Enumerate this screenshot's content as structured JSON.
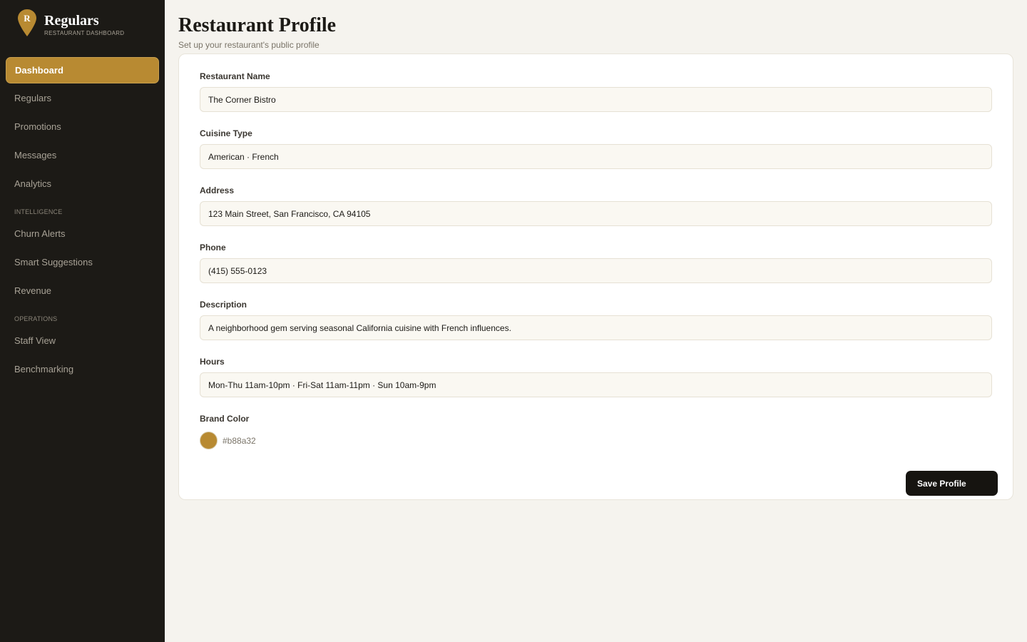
{
  "brand": {
    "initial": "R",
    "name": "Regulars",
    "subtitle": "RESTAURANT DASHBOARD",
    "accent": "#b88a32"
  },
  "sidebar": {
    "items": [
      {
        "label": "Dashboard",
        "active": true
      },
      {
        "label": "Regulars"
      },
      {
        "label": "Promotions"
      },
      {
        "label": "Messages"
      },
      {
        "label": "Analytics"
      }
    ],
    "section_intelligence": "INTELLIGENCE",
    "intelligence_items": [
      {
        "label": "Churn Alerts"
      },
      {
        "label": "Smart Suggestions"
      },
      {
        "label": "Revenue"
      }
    ],
    "section_operations": "OPERATIONS",
    "operations_items": [
      {
        "label": "Staff View"
      },
      {
        "label": "Benchmarking"
      }
    ]
  },
  "page": {
    "title": "Restaurant Profile",
    "subtitle": "Set up your restaurant's public profile"
  },
  "form": {
    "name_label": "Restaurant Name",
    "name_value": "The Corner Bistro",
    "cuisine_label": "Cuisine Type",
    "cuisine_value": "American · French",
    "address_label": "Address",
    "address_value": "123 Main Street, San Francisco, CA 94105",
    "phone_label": "Phone",
    "phone_value": "(415) 555-0123",
    "description_label": "Description",
    "description_value": "A neighborhood gem serving seasonal California cuisine with French influences.",
    "hours_label": "Hours",
    "hours_value": "Mon-Thu 11am-10pm · Fri-Sat 11am-11pm · Sun 10am-9pm",
    "brand_color_label": "Brand Color",
    "brand_color_value": "#b88a32",
    "save_label": "Save Profile"
  }
}
